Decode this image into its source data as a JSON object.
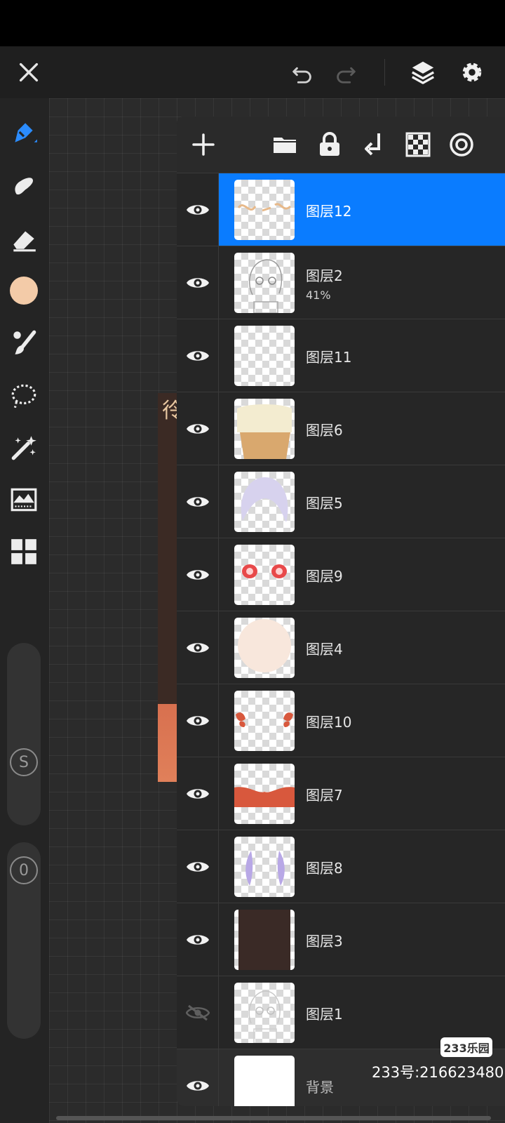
{
  "topbar": {
    "close_icon": "close-icon",
    "undo_icon": "undo-icon",
    "redo_icon": "redo-icon",
    "layers_icon": "layers-icon",
    "settings_icon": "gear-icon"
  },
  "tools": [
    {
      "name": "brush-tool-icon"
    },
    {
      "name": "smudge-tool-icon"
    },
    {
      "name": "eraser-tool-icon"
    },
    {
      "name": "color-swatch",
      "color": "#f3cba8"
    },
    {
      "name": "paint-brush-settings-icon"
    },
    {
      "name": "lasso-select-icon"
    },
    {
      "name": "magic-wand-icon"
    },
    {
      "name": "adjustments-icon"
    },
    {
      "name": "gallery-grid-icon"
    }
  ],
  "sliders": {
    "size_label": "S",
    "opacity_label": "0"
  },
  "layers_header": {
    "add_icon": "plus-icon",
    "folder_icon": "folder-icon",
    "lock_icon": "lock-icon",
    "merge_down_icon": "merge-down-icon",
    "transparency_icon": "checker-icon",
    "reference_icon": "target-icon"
  },
  "layers": [
    {
      "name": "图层12",
      "visible": true,
      "selected": true
    },
    {
      "name": "图层2",
      "opacity": "41%",
      "visible": true
    },
    {
      "name": "图层11",
      "visible": true
    },
    {
      "name": "图层6",
      "visible": true
    },
    {
      "name": "图层5",
      "visible": true
    },
    {
      "name": "图层9",
      "visible": true
    },
    {
      "name": "图层4",
      "visible": true
    },
    {
      "name": "图层10",
      "visible": true
    },
    {
      "name": "图层7",
      "visible": true
    },
    {
      "name": "图层8",
      "visible": true
    },
    {
      "name": "图层3",
      "visible": true
    },
    {
      "name": "图层1",
      "visible": false
    },
    {
      "name": "背景",
      "visible": true
    }
  ],
  "watermark": {
    "badge": "233乐园",
    "id_text": "233号:216623480"
  },
  "colors": {
    "accent": "#0a7cff",
    "panel": "#262626",
    "primary_color_swatch": "#f3cba8"
  }
}
